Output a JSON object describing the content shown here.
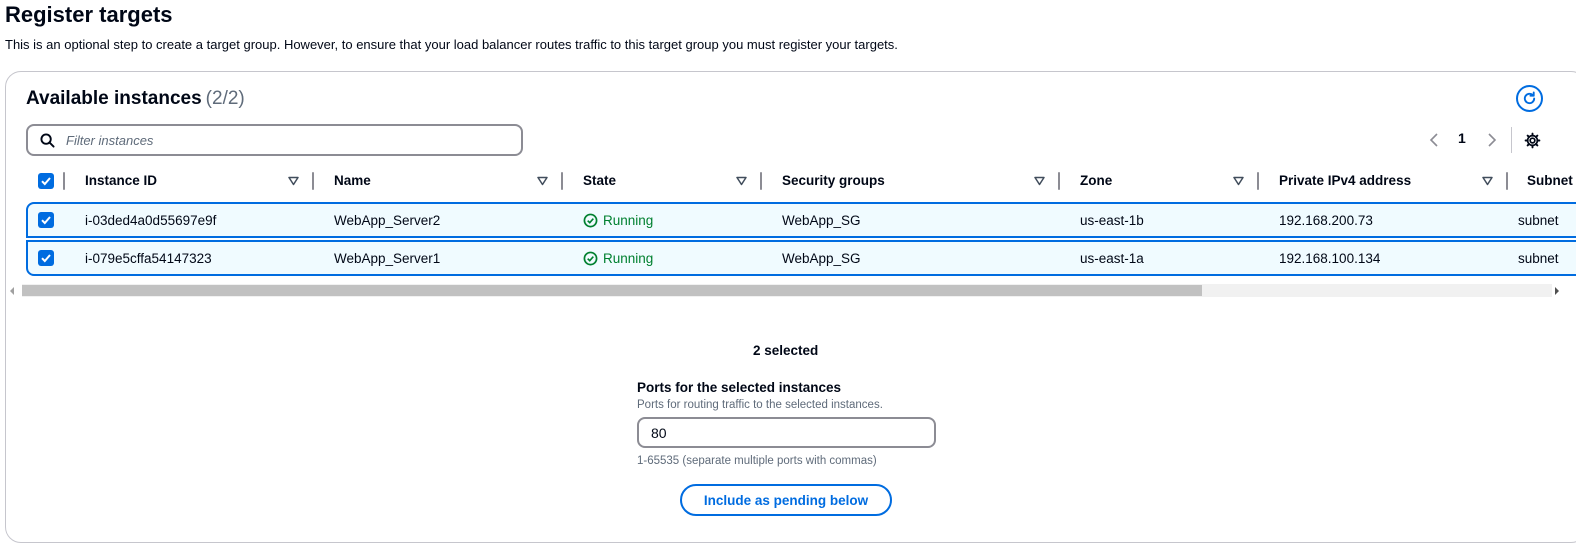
{
  "page": {
    "title": "Register targets",
    "description": "This is an optional step to create a target group. However, to ensure that your load balancer routes traffic to this target group you must register your targets."
  },
  "panel": {
    "title": "Available instances",
    "count": "(2/2)",
    "search_placeholder": "Filter instances",
    "page_number": "1"
  },
  "table": {
    "columns": [
      "Instance ID",
      "Name",
      "State",
      "Security groups",
      "Zone",
      "Private IPv4 address",
      "Subnet"
    ],
    "rows": [
      {
        "selected": true,
        "instance_id": "i-03ded4a0d55697e9f",
        "name": "WebApp_Server2",
        "state": "Running",
        "security_groups": "WebApp_SG",
        "zone": "us-east-1b",
        "ip": "192.168.200.73",
        "subnet": "subnet"
      },
      {
        "selected": true,
        "instance_id": "i-079e5cffa54147323",
        "name": "WebApp_Server1",
        "state": "Running",
        "security_groups": "WebApp_SG",
        "zone": "us-east-1a",
        "ip": "192.168.100.134",
        "subnet": "subnet"
      }
    ]
  },
  "selection": {
    "summary": "2 selected",
    "ports_label": "Ports for the selected instances",
    "ports_description": "Ports for routing traffic to the selected instances.",
    "ports_value": "80",
    "ports_hint": "1-65535 (separate multiple ports with commas)",
    "include_button": "Include as pending below"
  },
  "colors": {
    "accent": "#006ce0",
    "running": "#00802f",
    "selected_row_bg": "#f0fbff"
  },
  "icons": [
    "refresh-icon",
    "search-icon",
    "chevron-left-icon",
    "chevron-right-icon",
    "settings-gear-icon",
    "sort-caret-icon",
    "checkbox-checked-icon",
    "status-running-icon"
  ]
}
